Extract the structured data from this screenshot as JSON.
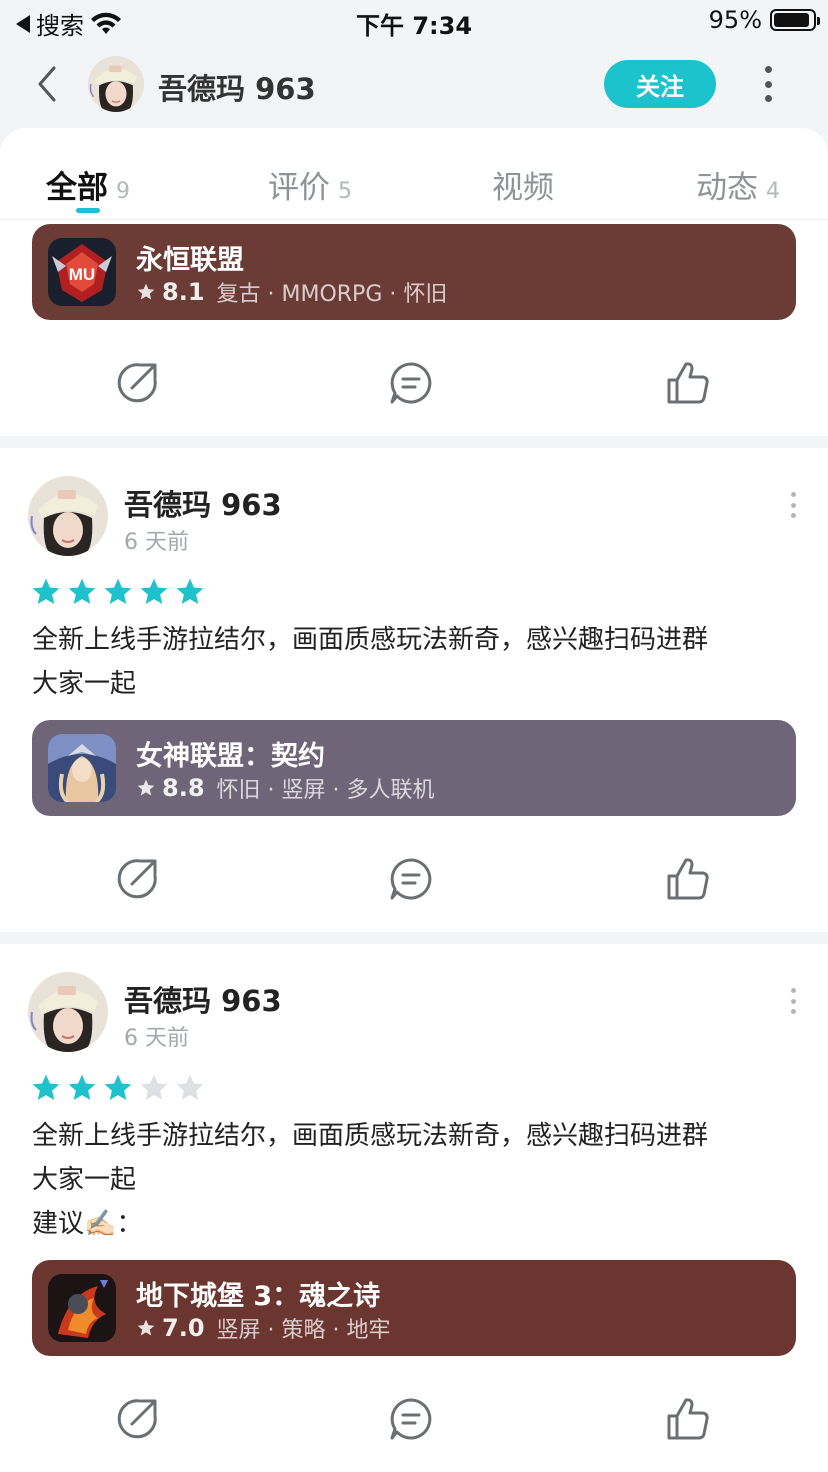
{
  "status_bar": {
    "back_app": "搜索",
    "time": "下午 7:34",
    "battery": "95%"
  },
  "nav": {
    "user_name": "吾德玛 963",
    "follow_label": "关注"
  },
  "tabs": [
    {
      "label": "全部",
      "count": "9"
    },
    {
      "label": "评价",
      "count": "5"
    },
    {
      "label": "视频",
      "count": ""
    },
    {
      "label": "动态",
      "count": "4"
    }
  ],
  "posts": [
    {
      "game": {
        "title": "永恒联盟",
        "rating": "8.1",
        "tags": "复古 · MMORPG · 怀旧",
        "bg": "#6b3b36"
      }
    },
    {
      "author": "吾德玛 963",
      "time": "6 天前",
      "stars": 5,
      "lines": [
        "全新上线手游拉结尔，画面质感玩法新奇，感兴趣扫码进群",
        "大家一起"
      ],
      "game": {
        "title": "女神联盟：契约",
        "rating": "8.8",
        "tags": "怀旧 · 竖屏 · 多人联机",
        "bg": "#6e6578"
      }
    },
    {
      "author": "吾德玛 963",
      "time": "6 天前",
      "stars": 3,
      "lines": [
        "全新上线手游拉结尔，画面质感玩法新奇，感兴趣扫码进群",
        "大家一起",
        "建议✍🏻："
      ],
      "game": {
        "title": "地下城堡 3：魂之诗",
        "rating": "7.0",
        "tags": "竖屏 · 策略 · 地牢",
        "bg": "#6b3530"
      }
    }
  ],
  "colors": {
    "accent": "#1cc2cc",
    "star_off": "#dde1e3"
  }
}
